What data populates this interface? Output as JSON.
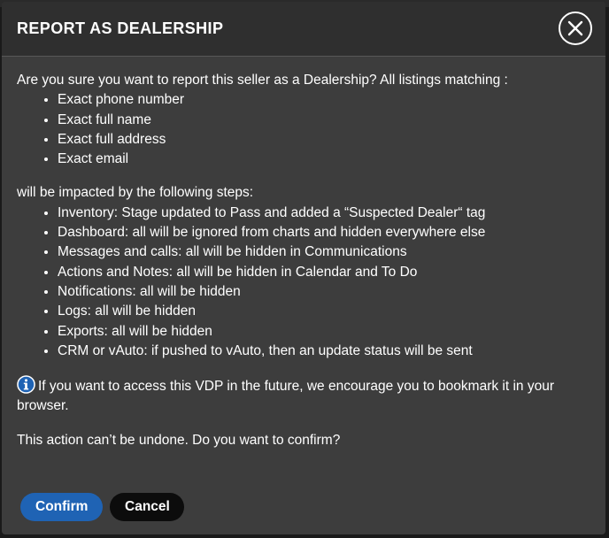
{
  "modal": {
    "title": "REPORT AS DEALERSHIP",
    "intro": "Are you sure you want to report this seller as a Dealership? All listings matching :",
    "match_criteria": [
      "Exact phone number",
      "Exact full name",
      "Exact full address",
      "Exact email"
    ],
    "steps_intro": "will be impacted by the following steps:",
    "steps": [
      "Inventory: Stage updated to Pass and added a “Suspected Dealer“ tag",
      "Dashboard: all will be ignored from charts and hidden everywhere else",
      "Messages and calls: all will be hidden in Communications",
      "Actions and Notes: all will be hidden in Calendar and To Do",
      "Notifications: all will be hidden",
      "Logs: all will be hidden",
      "Exports: all will be hidden",
      "CRM or vAuto: if pushed to vAuto, then an update status will be sent"
    ],
    "info_text": "If you want to access this VDP in the future, we encourage you to bookmark it in your browser.",
    "confirm_question": "This action can’t be undone. Do you want to confirm?",
    "confirm_label": "Confirm",
    "cancel_label": "Cancel"
  },
  "icons": {
    "close": "close-icon",
    "info": "info-icon"
  },
  "colors": {
    "modal_background": "#3d3d3d",
    "header_background": "#2f2f2f",
    "confirm_button": "#1f63b4",
    "cancel_button": "#0c0c0c",
    "info_icon": "#1f63b4",
    "text": "#ffffff"
  }
}
